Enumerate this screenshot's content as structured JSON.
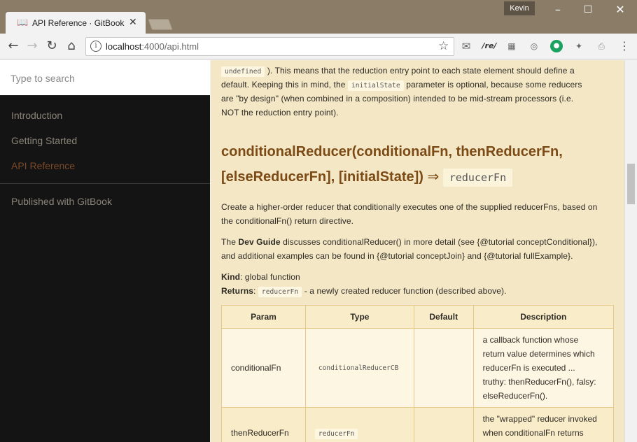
{
  "browser": {
    "tab_title": "API Reference · GitBook",
    "tab_close": "✕",
    "profile_name": "Kevin",
    "url_host": "localhost",
    "url_rest": ":4000/api.html",
    "ext_re": "/re/"
  },
  "sidebar": {
    "search_placeholder": "Type to search",
    "items": [
      {
        "label": "Introduction",
        "active": false
      },
      {
        "label": "Getting Started",
        "active": false
      },
      {
        "label": "API Reference",
        "active": true
      }
    ],
    "published": "Published with GitBook"
  },
  "content": {
    "intro": {
      "code_undefined": "undefined",
      "l1_rest": "). This means that the reduction entry point to each state element should define a",
      "l2_a": "default. Keeping this in mind, the",
      "code_initial": "initialState",
      "l2_b": "parameter is optional, because some reducers",
      "l3": "are \"by design\" (when combined in a composition) intended to be mid-stream processors (i.e.",
      "l4": "NOT the reduction entry point)."
    },
    "heading_line1": "conditionalReducer(conditionalFn, thenReducerFn,",
    "heading_line2": "[elseReducerFn], [initialState])",
    "heading_arrow": "⇒",
    "heading_ret": "reducerFn",
    "desc_l1": "Create a higher-order reducer that conditionally executes one of the supplied reducerFns, based on",
    "desc_l2": "the conditionalFn() return directive.",
    "guide_a": "The",
    "guide_bold": "Dev Guide",
    "guide_b": "discusses conditionalReducer() in more detail (see {@tutorial conceptConditional}),",
    "guide_l2": "and additional examples can be found in {@tutorial conceptJoin} and {@tutorial fullExample}.",
    "kind_label": "Kind",
    "kind_value": ": global function",
    "returns_label": "Returns",
    "returns_code": "reducerFn",
    "returns_value": "- a newly created reducer function (described above).",
    "table": {
      "headers": [
        "Param",
        "Type",
        "Default",
        "Description"
      ],
      "rows": [
        {
          "param": "conditionalFn",
          "type": "conditionalReducerCB",
          "default": "",
          "desc": [
            "a callback function whose",
            "return value determines which",
            "reducerFn is executed ...",
            "truthy: thenReducerFn(), falsy:",
            "elseReducerFn()."
          ]
        },
        {
          "param": "thenReducerFn",
          "type": "reducerFn",
          "default": "",
          "desc": [
            "the \"wrapped\" reducer invoked",
            "when conditionalFn returns"
          ]
        }
      ]
    }
  }
}
